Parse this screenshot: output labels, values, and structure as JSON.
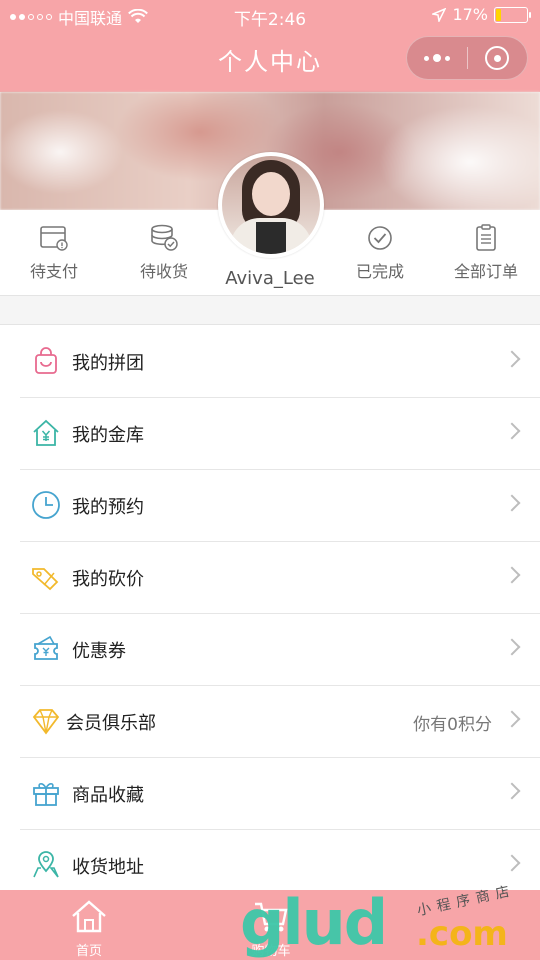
{
  "status_bar": {
    "carrier": "中国联通",
    "time": "下午2:46",
    "battery": "17%",
    "battery_level": 0.17
  },
  "nav": {
    "title": "个人中心",
    "more_icon": "more-dots-icon",
    "close_icon": "target-circle-icon"
  },
  "user": {
    "name": "Aviva_Lee"
  },
  "orders": [
    {
      "label": "待支付",
      "icon": "wallet-icon"
    },
    {
      "label": "待收货",
      "icon": "coins-check-icon"
    },
    {
      "label": "已完成",
      "icon": "check-circle-icon"
    },
    {
      "label": "全部订单",
      "icon": "clipboard-icon"
    }
  ],
  "menu": [
    {
      "label": "我的拼团",
      "icon": "shopping-bag-icon",
      "extra": ""
    },
    {
      "label": "我的金库",
      "icon": "house-yen-icon",
      "extra": ""
    },
    {
      "label": "我的预约",
      "icon": "clock-icon",
      "extra": ""
    },
    {
      "label": "我的砍价",
      "icon": "price-tag-icon",
      "extra": ""
    },
    {
      "label": "优惠券",
      "icon": "coupon-icon",
      "extra": ""
    },
    {
      "label": "会员俱乐部",
      "icon": "diamond-icon",
      "extra": "你有0积分"
    },
    {
      "label": "商品收藏",
      "icon": "gift-icon",
      "extra": ""
    },
    {
      "label": "收货地址",
      "icon": "location-pin-icon",
      "extra": ""
    }
  ],
  "tabbar": [
    {
      "label": "首页",
      "icon": "home-icon"
    },
    {
      "label": "购物车",
      "icon": "cart-icon"
    }
  ],
  "watermark": {
    "main": "glud",
    "suffix": ".com",
    "sub": "小程序商店"
  },
  "colors": {
    "brand_pink": "#f7a5a8",
    "text_dark": "#222222",
    "text_gray": "#777777"
  }
}
